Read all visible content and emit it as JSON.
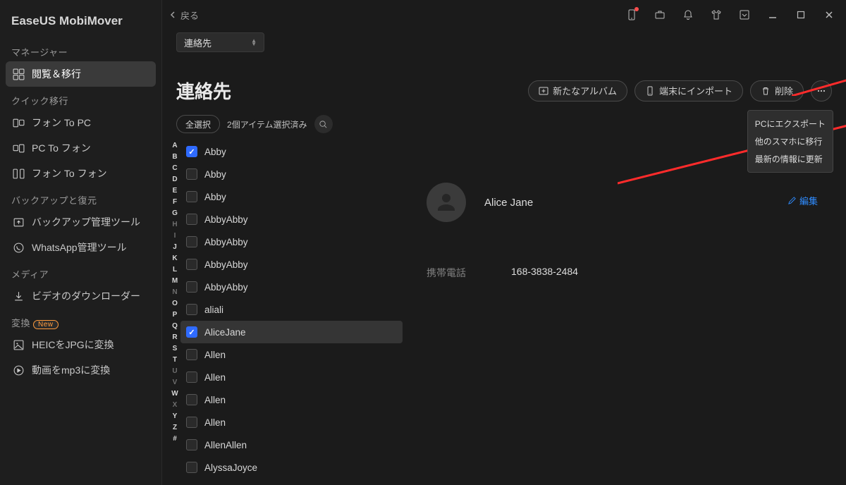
{
  "app_name": "EaseUS MobiMover",
  "back_label": "戻る",
  "selector_value": "連絡先",
  "page_title": "連絡先",
  "header_actions": {
    "new_album": "新たなアルバム",
    "import_device": "端末にインポート",
    "delete": "削除"
  },
  "more_menu": [
    "PCにエクスポート",
    "他のスマホに移行",
    "最新の情報に更新"
  ],
  "select_all": "全選択",
  "selected_count_text": "2個アイテム選択済み",
  "sidebar": {
    "sections": [
      {
        "label": "マネージャー",
        "items": [
          {
            "icon": "grid",
            "label": "閲覧＆移行",
            "active": true
          }
        ]
      },
      {
        "label": "クイック移行",
        "items": [
          {
            "icon": "phone-pc",
            "label": "フォン To PC"
          },
          {
            "icon": "pc-phone",
            "label": "PC To フォン"
          },
          {
            "icon": "phone-phone",
            "label": "フォン To フォン"
          }
        ]
      },
      {
        "label": "バックアップと復元",
        "items": [
          {
            "icon": "backup",
            "label": "バックアップ管理ツール"
          },
          {
            "icon": "whatsapp",
            "label": "WhatsApp管理ツール"
          }
        ]
      },
      {
        "label": "メディア",
        "items": [
          {
            "icon": "download",
            "label": "ビデオのダウンローダー"
          }
        ]
      },
      {
        "label": "変換",
        "badge": "New",
        "items": [
          {
            "icon": "heic",
            "label": "HEICをJPGに変換"
          },
          {
            "icon": "mp3",
            "label": "動画をmp3に変換"
          }
        ]
      }
    ]
  },
  "alpha_index": [
    "A",
    "B",
    "C",
    "D",
    "E",
    "F",
    "G",
    "H",
    "I",
    "J",
    "K",
    "L",
    "M",
    "N",
    "O",
    "P",
    "Q",
    "R",
    "S",
    "T",
    "U",
    "V",
    "W",
    "X",
    "Y",
    "Z",
    "#"
  ],
  "alpha_active": [
    "A",
    "B",
    "C",
    "D",
    "E",
    "F",
    "G",
    "J",
    "K",
    "L",
    "M",
    "O",
    "P",
    "Q",
    "R",
    "S",
    "T",
    "W",
    "Y",
    "Z",
    "#"
  ],
  "contacts": [
    {
      "name": "Abby",
      "checked": true
    },
    {
      "name": "Abby"
    },
    {
      "name": "Abby"
    },
    {
      "name": "AbbyAbby"
    },
    {
      "name": "AbbyAbby"
    },
    {
      "name": "AbbyAbby"
    },
    {
      "name": "AbbyAbby"
    },
    {
      "name": "aliali"
    },
    {
      "name": "AliceJane",
      "checked": true,
      "selected": true
    },
    {
      "name": "Allen"
    },
    {
      "name": "Allen"
    },
    {
      "name": "Allen"
    },
    {
      "name": "Allen"
    },
    {
      "name": "AllenAllen"
    },
    {
      "name": "AlyssaJoyce"
    }
  ],
  "detail": {
    "name": "Alice Jane",
    "edit": "編集",
    "phone_label": "携帯電話",
    "phone_value": "168-3838-2484"
  }
}
